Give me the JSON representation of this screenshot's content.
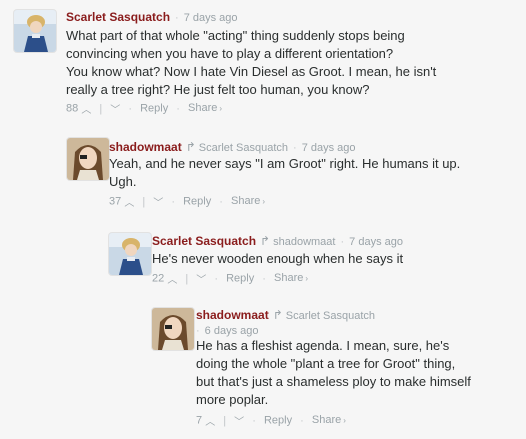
{
  "comments": [
    {
      "author": "Scarlet Sasquatch",
      "reply_to": "",
      "timestamp": "7 days ago",
      "body": [
        "What part of that whole \"acting\" thing suddenly stops being",
        "convincing when you have to play a different orientation?",
        "You know what? Now I hate Vin Diesel as Groot. I mean, he isn't",
        "really a tree right? He just felt too human, you know?"
      ],
      "votes": "88",
      "reply_label": "Reply",
      "share_label": "Share"
    },
    {
      "author": "shadowmaat",
      "reply_to": "Scarlet Sasquatch",
      "timestamp": "7 days ago",
      "body": [
        "Yeah, and he never says \"I am Groot\" right. He humans it up.",
        "Ugh."
      ],
      "votes": "37",
      "reply_label": "Reply",
      "share_label": "Share"
    },
    {
      "author": "Scarlet Sasquatch",
      "reply_to": "shadowmaat",
      "timestamp": "7 days ago",
      "body": [
        "He's never wooden enough when he says it"
      ],
      "votes": "22",
      "reply_label": "Reply",
      "share_label": "Share"
    },
    {
      "author": "shadowmaat",
      "reply_to": "Scarlet Sasquatch",
      "timestamp": "6 days ago",
      "body": [
        "He has a fleshist agenda. I mean, sure, he's",
        "doing the whole \"plant a tree for Groot\" thing,",
        "but that's just a shameless ploy to make himself",
        "more poplar."
      ],
      "votes": "7",
      "reply_label": "Reply",
      "share_label": "Share"
    }
  ],
  "icons": {
    "reply_arrow": "reply-arrow-icon",
    "vote_up": "upvote-icon",
    "vote_down": "downvote-icon",
    "share_arrow": "share-arrow-icon"
  },
  "colors": {
    "author": "#8a1c1c",
    "meta": "#9aa3a8",
    "text": "#2a2e2e",
    "background": "#f6f6f6"
  }
}
